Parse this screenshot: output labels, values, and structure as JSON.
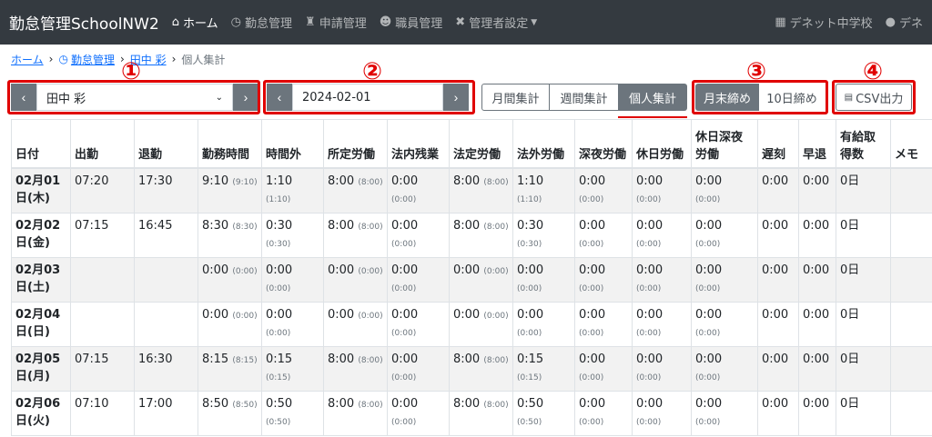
{
  "navbar": {
    "brand": "勤怠管理SchoolNW2",
    "items": [
      {
        "icon": "home-icon",
        "label": "ホーム",
        "active": true
      },
      {
        "icon": "clock-icon",
        "label": "勤怠管理"
      },
      {
        "icon": "stamp-icon",
        "label": "申請管理"
      },
      {
        "icon": "users-icon",
        "label": "職員管理"
      },
      {
        "icon": "tools-icon",
        "label": "管理者設定"
      }
    ],
    "school": "デネット中学校",
    "user": "デネ"
  },
  "breadcrumb": {
    "home": "ホーム",
    "attendance": "勤怠管理",
    "person": "田中 彩",
    "current": "個人集計"
  },
  "toolbar": {
    "employee_select": "田中 彩",
    "date_value": "2024-02-01",
    "views": [
      "月間集計",
      "週間集計",
      "個人集計"
    ],
    "closing": [
      "月末締め",
      "10日締め"
    ],
    "csv_label": "CSV出力",
    "markers": [
      "①",
      "②",
      "③",
      "④"
    ]
  },
  "table": {
    "headers": [
      "日付",
      "出勤",
      "退勤",
      "勤務時間",
      "時間外",
      "所定労働",
      "法内残業",
      "法定労働",
      "法外労働",
      "深夜労働",
      "休日労働",
      "休日深夜労働",
      "遅刻",
      "早退",
      "有給取得数",
      "メモ"
    ],
    "rows": [
      {
        "date": "02月01日(木)",
        "in": "07:20",
        "out": "17:30",
        "work": "9:10",
        "work_s": "(9:10)",
        "ot": "1:10",
        "ot_s": "(1:10)",
        "reg": "8:00",
        "reg_s": "(8:00)",
        "inner": "0:00",
        "inner_s": "(0:00)",
        "legal": "8:00",
        "legal_s": "(8:00)",
        "extra": "1:10",
        "extra_s": "(1:10)",
        "night": "0:00",
        "night_s": "(0:00)",
        "hol": "0:00",
        "hol_s": "(0:00)",
        "holn": "0:00",
        "holn_s": "(0:00)",
        "late": "0:00",
        "early": "0:00",
        "paid": "0日",
        "memo": ""
      },
      {
        "date": "02月02日(金)",
        "in": "07:15",
        "out": "16:45",
        "work": "8:30",
        "work_s": "(8:30)",
        "ot": "0:30",
        "ot_s": "(0:30)",
        "reg": "8:00",
        "reg_s": "(8:00)",
        "inner": "0:00",
        "inner_s": "(0:00)",
        "legal": "8:00",
        "legal_s": "(8:00)",
        "extra": "0:30",
        "extra_s": "(0:30)",
        "night": "0:00",
        "night_s": "(0:00)",
        "hol": "0:00",
        "hol_s": "(0:00)",
        "holn": "0:00",
        "holn_s": "(0:00)",
        "late": "0:00",
        "early": "0:00",
        "paid": "0日",
        "memo": ""
      },
      {
        "date": "02月03日(土)",
        "in": "",
        "out": "",
        "work": "0:00",
        "work_s": "(0:00)",
        "ot": "0:00",
        "ot_s": "(0:00)",
        "reg": "0:00",
        "reg_s": "(0:00)",
        "inner": "0:00",
        "inner_s": "(0:00)",
        "legal": "0:00",
        "legal_s": "(0:00)",
        "extra": "0:00",
        "extra_s": "(0:00)",
        "night": "0:00",
        "night_s": "(0:00)",
        "hol": "0:00",
        "hol_s": "(0:00)",
        "holn": "0:00",
        "holn_s": "(0:00)",
        "late": "0:00",
        "early": "0:00",
        "paid": "0日",
        "memo": ""
      },
      {
        "date": "02月04日(日)",
        "in": "",
        "out": "",
        "work": "0:00",
        "work_s": "(0:00)",
        "ot": "0:00",
        "ot_s": "(0:00)",
        "reg": "0:00",
        "reg_s": "(0:00)",
        "inner": "0:00",
        "inner_s": "(0:00)",
        "legal": "0:00",
        "legal_s": "(0:00)",
        "extra": "0:00",
        "extra_s": "(0:00)",
        "night": "0:00",
        "night_s": "(0:00)",
        "hol": "0:00",
        "hol_s": "(0:00)",
        "holn": "0:00",
        "holn_s": "(0:00)",
        "late": "0:00",
        "early": "0:00",
        "paid": "0日",
        "memo": ""
      },
      {
        "date": "02月05日(月)",
        "in": "07:15",
        "out": "16:30",
        "work": "8:15",
        "work_s": "(8:15)",
        "ot": "0:15",
        "ot_s": "(0:15)",
        "reg": "8:00",
        "reg_s": "(8:00)",
        "inner": "0:00",
        "inner_s": "(0:00)",
        "legal": "8:00",
        "legal_s": "(8:00)",
        "extra": "0:15",
        "extra_s": "(0:15)",
        "night": "0:00",
        "night_s": "(0:00)",
        "hol": "0:00",
        "hol_s": "(0:00)",
        "holn": "0:00",
        "holn_s": "(0:00)",
        "late": "0:00",
        "early": "0:00",
        "paid": "0日",
        "memo": ""
      },
      {
        "date": "02月06日(火)",
        "in": "07:10",
        "out": "17:00",
        "work": "8:50",
        "work_s": "(8:50)",
        "ot": "0:50",
        "ot_s": "(0:50)",
        "reg": "8:00",
        "reg_s": "(8:00)",
        "inner": "0:00",
        "inner_s": "(0:00)",
        "legal": "8:00",
        "legal_s": "(8:00)",
        "extra": "0:50",
        "extra_s": "(0:50)",
        "night": "0:00",
        "night_s": "(0:00)",
        "hol": "0:00",
        "hol_s": "(0:00)",
        "holn": "0:00",
        "holn_s": "(0:00)",
        "late": "0:00",
        "early": "0:00",
        "paid": "0日",
        "memo": ""
      }
    ]
  }
}
